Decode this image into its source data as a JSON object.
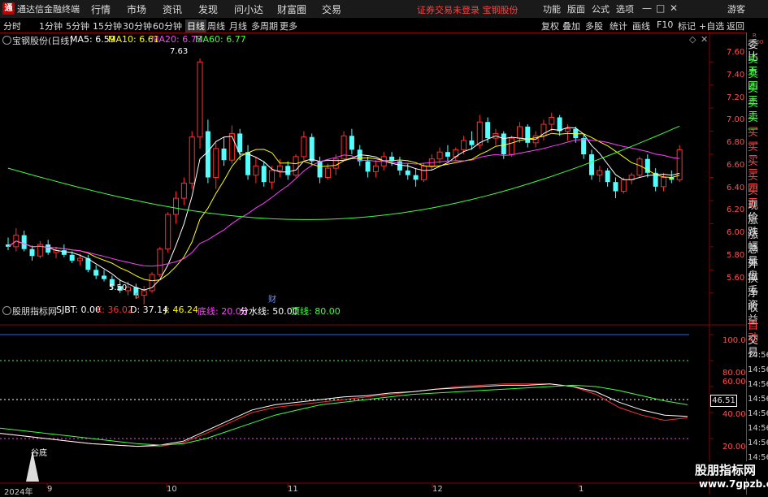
{
  "titlebar": {
    "app_logo": "通",
    "app_title": "通达信金融终端",
    "menu": [
      "行情",
      "市场",
      "资讯",
      "发现",
      "问小达",
      "财富圈",
      "交易"
    ],
    "login_status": "证券交易未登录  宝钢股份",
    "right_menu": [
      "功能",
      "版面",
      "公式",
      "选项"
    ],
    "account_label": "游客",
    "window_controls": [
      "—",
      "□",
      "✕"
    ]
  },
  "toolbar": {
    "periods": [
      "分时",
      "1分钟",
      "5分钟",
      "15分钟",
      "30分钟",
      "60分钟",
      "日线",
      "周线",
      "月线",
      "多周期",
      "更多"
    ],
    "active_period": "日线",
    "buttons": [
      "复权",
      "叠加",
      "多股",
      "统计",
      "画线",
      "F10",
      "标记",
      "+自选",
      "返回"
    ]
  },
  "price_panel": {
    "stock_label": "宝钢股份(日线)",
    "ma": [
      {
        "label": "MA5: 6.59",
        "color": "#ffffff"
      },
      {
        "label": "MA10: 6.61",
        "color": "#ffff00"
      },
      {
        "label": "MA20: 6.73",
        "color": "#ff40ff"
      },
      {
        "label": "MA60: 6.77",
        "color": "#40ff40"
      }
    ],
    "high_label": "7.63",
    "low_label": "5.50",
    "marker_s": "S",
    "marker_cai": "财",
    "ticks": [
      "7.60",
      "7.40",
      "7.20",
      "7.00",
      "6.80",
      "6.60",
      "6.40",
      "6.20",
      "6.00",
      "5.80",
      "5.60"
    ]
  },
  "indicator_panel": {
    "name": "股朋指标网",
    "values": [
      {
        "label": "SJBT: 0.00",
        "color": "#ffffff"
      },
      {
        "label": "K: 36.02",
        "color": "#ff3030"
      },
      {
        "label": "D: 37.14",
        "color": "#ffffff"
      },
      {
        "label": "J: 46.24",
        "color": "#ffff00"
      },
      {
        "label": "底线: 20.00",
        "color": "#ff40ff"
      },
      {
        "label": "分水线: 50.00",
        "color": "#ffffff"
      },
      {
        "label": "顶线: 80.00",
        "color": "#40ff40"
      }
    ],
    "ticks": [
      "100.0",
      "80.00",
      "60.00",
      "40.00",
      "20.00"
    ],
    "current_value": "46.51",
    "signal_label": "谷底"
  },
  "chart_data": [
    {
      "type": "candlestick",
      "title": "宝钢股份(日线)",
      "ylim": [
        5.5,
        7.7
      ],
      "moving_averages": {
        "MA5": 6.59,
        "MA10": 6.61,
        "MA20": 6.73,
        "MA60": 6.77
      },
      "annotations": {
        "high": 7.63,
        "low": 5.5
      },
      "x_ticks": [
        "2024年",
        "9",
        "10",
        "11",
        "12",
        "1"
      ],
      "ohlc": [
        [
          6.02,
          6.08,
          5.97,
          6.0
        ],
        [
          6.0,
          6.16,
          5.96,
          6.1
        ],
        [
          6.1,
          6.14,
          5.96,
          5.98
        ],
        [
          5.98,
          6.01,
          5.88,
          5.92
        ],
        [
          5.92,
          6.05,
          5.9,
          6.02
        ],
        [
          6.02,
          6.06,
          5.93,
          5.95
        ],
        [
          5.95,
          6.0,
          5.9,
          5.97
        ],
        [
          5.97,
          6.02,
          5.91,
          5.93
        ],
        [
          5.93,
          5.96,
          5.86,
          5.88
        ],
        [
          5.88,
          5.94,
          5.84,
          5.9
        ],
        [
          5.9,
          5.93,
          5.78,
          5.8
        ],
        [
          5.8,
          5.84,
          5.72,
          5.75
        ],
        [
          5.75,
          5.8,
          5.7,
          5.72
        ],
        [
          5.72,
          5.75,
          5.63,
          5.66
        ],
        [
          5.66,
          5.72,
          5.6,
          5.62
        ],
        [
          5.62,
          5.7,
          5.58,
          5.65
        ],
        [
          5.65,
          5.68,
          5.55,
          5.58
        ],
        [
          5.58,
          5.66,
          5.5,
          5.62
        ],
        [
          5.62,
          5.78,
          5.6,
          5.76
        ],
        [
          5.76,
          6.0,
          5.74,
          5.98
        ],
        [
          5.98,
          6.3,
          5.95,
          6.28
        ],
        [
          6.28,
          6.48,
          6.2,
          6.42
        ],
        [
          6.42,
          6.6,
          6.36,
          6.55
        ],
        [
          6.55,
          7.0,
          6.5,
          6.95
        ],
        [
          6.95,
          7.63,
          6.85,
          7.6
        ],
        [
          7.0,
          7.1,
          6.55,
          6.6
        ],
        [
          6.6,
          6.9,
          6.5,
          6.85
        ],
        [
          6.85,
          6.95,
          6.7,
          6.75
        ],
        [
          6.75,
          7.05,
          6.72,
          6.98
        ],
        [
          6.98,
          7.02,
          6.75,
          6.82
        ],
        [
          6.82,
          6.88,
          6.58,
          6.62
        ],
        [
          6.62,
          6.78,
          6.55,
          6.7
        ],
        [
          6.7,
          6.74,
          6.52,
          6.56
        ],
        [
          6.56,
          6.7,
          6.5,
          6.66
        ],
        [
          6.66,
          6.76,
          6.6,
          6.7
        ],
        [
          6.7,
          6.74,
          6.58,
          6.62
        ],
        [
          6.62,
          6.8,
          6.6,
          6.78
        ],
        [
          6.78,
          7.0,
          6.75,
          6.95
        ],
        [
          6.95,
          6.98,
          6.7,
          6.74
        ],
        [
          6.74,
          6.78,
          6.55,
          6.6
        ],
        [
          6.6,
          6.72,
          6.58,
          6.68
        ],
        [
          6.68,
          6.8,
          6.62,
          6.76
        ],
        [
          6.76,
          7.0,
          6.74,
          6.96
        ],
        [
          6.96,
          7.02,
          6.8,
          6.84
        ],
        [
          6.84,
          6.88,
          6.7,
          6.74
        ],
        [
          6.74,
          6.78,
          6.6,
          6.65
        ],
        [
          6.65,
          6.75,
          6.6,
          6.7
        ],
        [
          6.7,
          6.82,
          6.66,
          6.78
        ],
        [
          6.78,
          6.82,
          6.7,
          6.74
        ],
        [
          6.74,
          6.78,
          6.62,
          6.66
        ],
        [
          6.66,
          6.72,
          6.58,
          6.62
        ],
        [
          6.62,
          6.68,
          6.52,
          6.58
        ],
        [
          6.58,
          6.72,
          6.56,
          6.7
        ],
        [
          6.7,
          6.8,
          6.66,
          6.76
        ],
        [
          6.76,
          6.86,
          6.72,
          6.82
        ],
        [
          6.82,
          6.88,
          6.74,
          6.78
        ],
        [
          6.78,
          6.86,
          6.74,
          6.84
        ],
        [
          6.84,
          6.96,
          6.8,
          6.92
        ],
        [
          6.92,
          7.0,
          6.84,
          6.88
        ],
        [
          6.88,
          7.14,
          6.85,
          7.08
        ],
        [
          7.08,
          7.12,
          6.9,
          6.94
        ],
        [
          6.94,
          7.02,
          6.88,
          6.98
        ],
        [
          6.98,
          7.0,
          6.76,
          6.8
        ],
        [
          6.8,
          6.96,
          6.78,
          6.94
        ],
        [
          6.94,
          7.08,
          6.9,
          7.04
        ],
        [
          7.04,
          7.06,
          6.86,
          6.9
        ],
        [
          6.9,
          7.0,
          6.86,
          6.96
        ],
        [
          6.96,
          7.1,
          6.92,
          7.06
        ],
        [
          7.06,
          7.16,
          7.0,
          7.12
        ],
        [
          7.12,
          7.14,
          6.96,
          7.0
        ],
        [
          7.0,
          7.06,
          6.92,
          7.02
        ],
        [
          7.02,
          7.04,
          6.9,
          6.94
        ],
        [
          6.94,
          6.98,
          6.76,
          6.8
        ],
        [
          6.8,
          6.84,
          6.58,
          6.62
        ],
        [
          6.62,
          6.7,
          6.56,
          6.66
        ],
        [
          6.66,
          6.68,
          6.52,
          6.56
        ],
        [
          6.56,
          6.6,
          6.42,
          6.48
        ],
        [
          6.48,
          6.6,
          6.46,
          6.58
        ],
        [
          6.58,
          6.64,
          6.54,
          6.62
        ],
        [
          6.62,
          6.78,
          6.6,
          6.76
        ],
        [
          6.76,
          6.8,
          6.6,
          6.64
        ],
        [
          6.64,
          6.68,
          6.48,
          6.52
        ],
        [
          6.52,
          6.64,
          6.48,
          6.6
        ],
        [
          6.6,
          6.66,
          6.55,
          6.58
        ],
        [
          6.58,
          6.88,
          6.56,
          6.84
        ]
      ]
    },
    {
      "type": "line",
      "title": "股朋指标网",
      "ylim": [
        0,
        100
      ],
      "reference_lines": {
        "底线": 20,
        "分水线": 50,
        "顶线": 80
      },
      "series": [
        {
          "name": "K",
          "color": "#ff3030",
          "values": [
            24,
            22,
            20,
            18,
            16,
            15,
            14,
            14,
            17,
            24,
            32,
            40,
            44,
            46,
            48,
            50,
            52,
            54,
            56,
            58,
            60,
            61,
            62,
            62,
            62,
            60,
            54,
            44,
            38,
            34,
            36
          ]
        },
        {
          "name": "D",
          "color": "#ffffff",
          "values": [
            24,
            22,
            20,
            18,
            16,
            15,
            14,
            15,
            18,
            26,
            34,
            42,
            46,
            48,
            50,
            52,
            53,
            55,
            56,
            58,
            59,
            60,
            61,
            61,
            62,
            60,
            56,
            48,
            42,
            38,
            37
          ]
        },
        {
          "name": "J",
          "color": "#40ff40",
          "values": [
            28,
            26,
            24,
            22,
            20,
            18,
            16,
            15,
            16,
            20,
            26,
            32,
            38,
            42,
            46,
            48,
            50,
            52,
            54,
            55,
            56,
            57,
            58,
            59,
            60,
            61,
            60,
            57,
            53,
            49,
            46
          ]
        }
      ]
    }
  ]
}
